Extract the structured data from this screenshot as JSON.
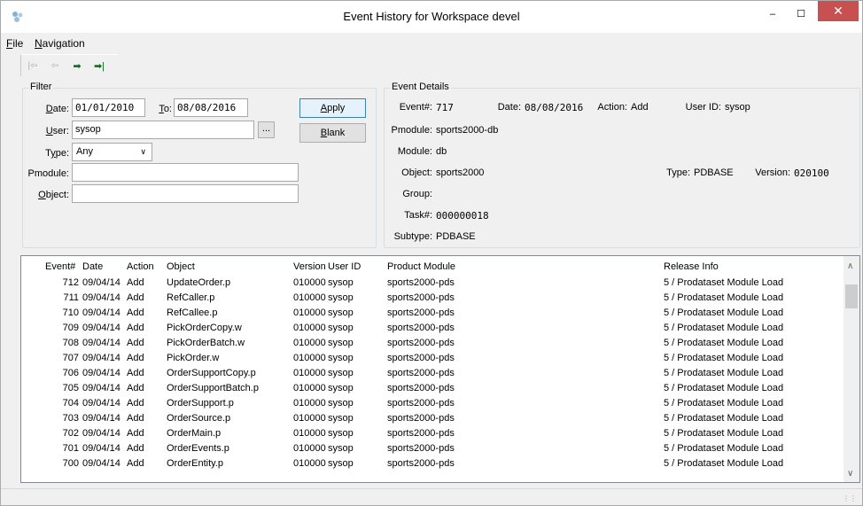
{
  "window": {
    "title": "Event History for Workspace devel",
    "minimize_glyph": "–",
    "maximize_glyph": "☐",
    "close_glyph": "✕"
  },
  "menu": {
    "file": {
      "accel": "F",
      "rest": "ile"
    },
    "navigation": {
      "accel": "N",
      "rest": "avigation"
    }
  },
  "toolbar": {
    "icons": [
      "first-icon",
      "previous-icon",
      "next-icon",
      "last-icon"
    ],
    "first": "|⇦",
    "prev": "⇦",
    "next": "➡",
    "last": "➡|"
  },
  "filter": {
    "group_label": "Filter",
    "date_label": {
      "accel": "D",
      "rest": "ate:"
    },
    "date_value": "01/01/2010",
    "to_label": {
      "accel": "T",
      "rest": "o:"
    },
    "to_value": "08/08/2016",
    "user_label": {
      "accel": "U",
      "rest": "ser:"
    },
    "user_value": "sysop",
    "browse_label": "...",
    "type_label": {
      "pre": "T",
      "accel": "y",
      "rest": "pe:"
    },
    "type_value": "Any",
    "pmodule_label": "Pmodule:",
    "pmodule_value": "",
    "object_label": {
      "accel": "O",
      "rest": "bject:"
    },
    "object_value": "",
    "apply_label": {
      "accel": "A",
      "rest": "pply"
    },
    "blank_label": {
      "accel": "B",
      "rest": "lank"
    }
  },
  "details": {
    "group_label": "Event Details",
    "event_label": "Event#:",
    "event_value": "717",
    "date_label": "Date:",
    "date_value": "08/08/2016",
    "action_label": "Action:",
    "action_value": "Add",
    "userid_label": "User ID:",
    "userid_value": "sysop",
    "pmodule_label": "Pmodule:",
    "pmodule_value": "sports2000-db",
    "module_label": "Module:",
    "module_value": "db",
    "object_label": "Object:",
    "object_value": "sports2000",
    "type_label": "Type:",
    "type_value": "PDBASE",
    "version_label": "Version:",
    "version_value": "020100",
    "group_label_field": "Group:",
    "group_value": "",
    "task_label": "Task#:",
    "task_value": "000000018",
    "subtype_label": "Subtype:",
    "subtype_value": "PDBASE"
  },
  "list": {
    "headers": [
      "Event#",
      "Date",
      "Action",
      "Object",
      "Version",
      "User ID",
      "Product Module",
      "Release Info"
    ],
    "rows": [
      [
        "712",
        "09/04/14",
        "Add",
        "UpdateOrder.p",
        "010000",
        "sysop",
        "sports2000-pds",
        "5 / Prodataset Module Load"
      ],
      [
        "711",
        "09/04/14",
        "Add",
        "RefCaller.p",
        "010000",
        "sysop",
        "sports2000-pds",
        "5 / Prodataset Module Load"
      ],
      [
        "710",
        "09/04/14",
        "Add",
        "RefCallee.p",
        "010000",
        "sysop",
        "sports2000-pds",
        "5 / Prodataset Module Load"
      ],
      [
        "709",
        "09/04/14",
        "Add",
        "PickOrderCopy.w",
        "010000",
        "sysop",
        "sports2000-pds",
        "5 / Prodataset Module Load"
      ],
      [
        "708",
        "09/04/14",
        "Add",
        "PickOrderBatch.w",
        "010000",
        "sysop",
        "sports2000-pds",
        "5 / Prodataset Module Load"
      ],
      [
        "707",
        "09/04/14",
        "Add",
        "PickOrder.w",
        "010000",
        "sysop",
        "sports2000-pds",
        "5 / Prodataset Module Load"
      ],
      [
        "706",
        "09/04/14",
        "Add",
        "OrderSupportCopy.p",
        "010000",
        "sysop",
        "sports2000-pds",
        "5 / Prodataset Module Load"
      ],
      [
        "705",
        "09/04/14",
        "Add",
        "OrderSupportBatch.p",
        "010000",
        "sysop",
        "sports2000-pds",
        "5 / Prodataset Module Load"
      ],
      [
        "704",
        "09/04/14",
        "Add",
        "OrderSupport.p",
        "010000",
        "sysop",
        "sports2000-pds",
        "5 / Prodataset Module Load"
      ],
      [
        "703",
        "09/04/14",
        "Add",
        "OrderSource.p",
        "010000",
        "sysop",
        "sports2000-pds",
        "5 / Prodataset Module Load"
      ],
      [
        "702",
        "09/04/14",
        "Add",
        "OrderMain.p",
        "010000",
        "sysop",
        "sports2000-pds",
        "5 / Prodataset Module Load"
      ],
      [
        "701",
        "09/04/14",
        "Add",
        "OrderEvents.p",
        "010000",
        "sysop",
        "sports2000-pds",
        "5 / Prodataset Module Load"
      ],
      [
        "700",
        "09/04/14",
        "Add",
        "OrderEntity.p",
        "010000",
        "sysop",
        "sports2000-pds",
        "5 / Prodataset Module Load"
      ]
    ]
  }
}
